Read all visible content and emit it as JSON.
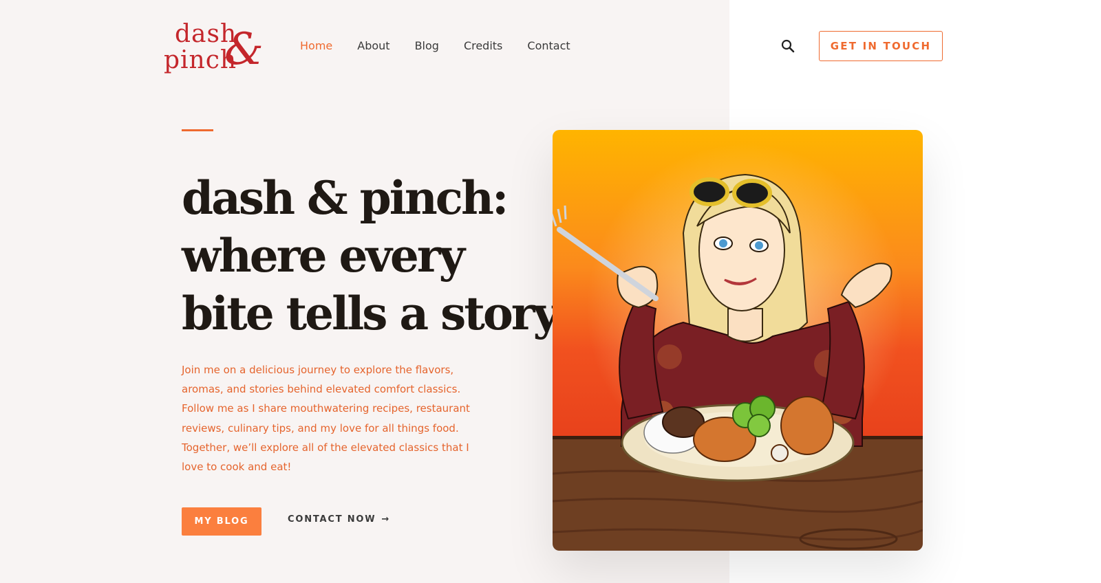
{
  "brand": {
    "logo_line1": "dash",
    "logo_line2": "pinch",
    "logo_amp": "&",
    "logo_color": "#c4262b"
  },
  "nav": {
    "items": [
      {
        "label": "Home",
        "active": true
      },
      {
        "label": "About",
        "active": false
      },
      {
        "label": "Blog",
        "active": false
      },
      {
        "label": "Credits",
        "active": false
      },
      {
        "label": "Contact",
        "active": false
      }
    ],
    "search_icon": "search-icon",
    "cta_label": "GET IN TOUCH"
  },
  "hero": {
    "title_lines": [
      "dash & pinch:",
      "where every",
      "bite tells a story"
    ],
    "description": "Join me on a delicious journey to explore the flavors, aromas, and stories behind elevated comfort classics. Follow me as I share mouthwatering recipes, restaurant reviews, culinary tips, and my love for all things food. Together, we’ll explore all of the elevated classics that I love to cook and eat!",
    "primary_button": "MY BLOG",
    "secondary_link": "CONTACT NOW",
    "secondary_arrow": "→"
  },
  "colors": {
    "accent": "#ef6a2f",
    "button_bg": "#fb7f3e",
    "left_panel_bg": "#f8f4f3",
    "title_text": "#1f1914"
  }
}
